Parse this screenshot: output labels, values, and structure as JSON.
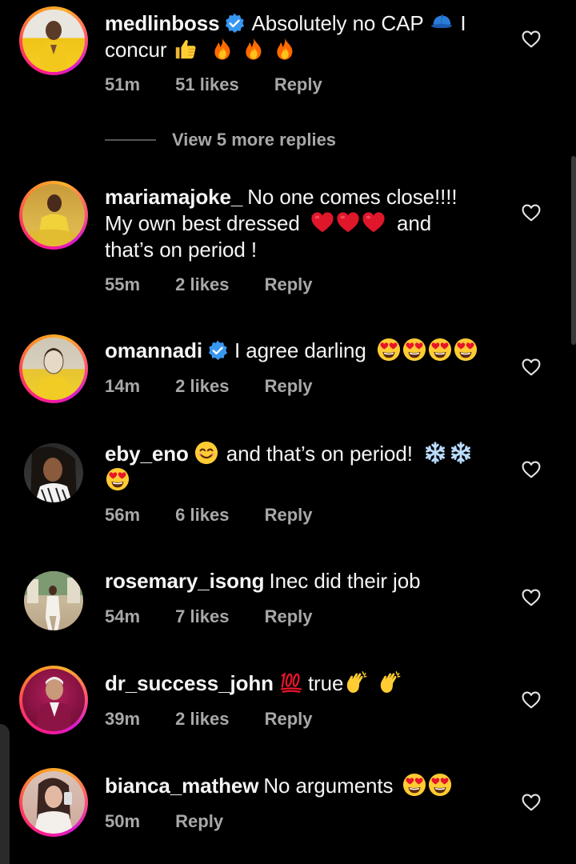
{
  "comments": [
    {
      "username": "medlinboss",
      "verified": true,
      "text_line1": "Absolutely no CAP",
      "text_after_cap": "I",
      "text_line2": "concur",
      "time": "51m",
      "likes": "51 likes",
      "reply": "Reply"
    },
    {
      "username": "mariamajoke_",
      "verified": false,
      "text_line1": "No one comes close!!!!",
      "text_line2": "My own best dressed",
      "text_line2_end": "and",
      "text_line3": "that’s on period !",
      "time": "55m",
      "likes": "2 likes",
      "reply": "Reply"
    },
    {
      "username": "omannadi",
      "verified": true,
      "text_line1": "I agree darling",
      "time": "14m",
      "likes": "2 likes",
      "reply": "Reply"
    },
    {
      "username": "eby_eno",
      "verified": false,
      "text_line1": "and that’s on period!",
      "time": "56m",
      "likes": "6 likes",
      "reply": "Reply"
    },
    {
      "username": "rosemary_isong",
      "verified": false,
      "text_line1": "Inec did their job",
      "time": "54m",
      "likes": "7 likes",
      "reply": "Reply"
    },
    {
      "username": "dr_success_john",
      "verified": false,
      "text_line1": "true",
      "time": "39m",
      "likes": "2 likes",
      "reply": "Reply"
    },
    {
      "username": "bianca_mathew",
      "verified": false,
      "text_line1": "No arguments",
      "time": "50m",
      "likes": "",
      "reply": "Reply"
    }
  ],
  "view_more": "View 5 more replies",
  "colors": {
    "background": "#000000",
    "text": "#f5f5f5",
    "meta": "#a8a8a8",
    "verified": "#3897f0",
    "story_ring": [
      "#ff1b8d",
      "#ff8a2a",
      "#d61bd1"
    ]
  },
  "icons": [
    "heart-outline-icon",
    "verified-badge-icon",
    "cap-emoji",
    "thumbs-up-emoji",
    "fire-emoji",
    "red-heart-emoji",
    "heart-eyes-emoji",
    "smiling-emoji",
    "snowflake-emoji",
    "hundred-points-emoji",
    "clapping-hands-emoji"
  ]
}
